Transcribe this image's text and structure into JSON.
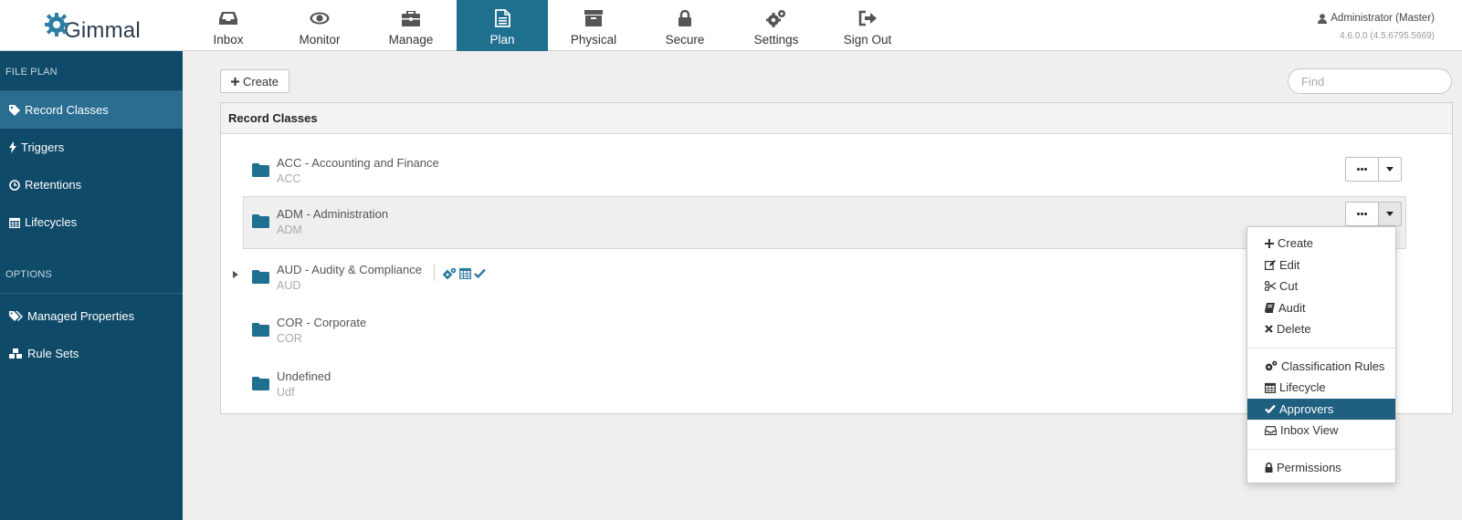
{
  "brand": {
    "name": "Gimmal"
  },
  "nav": [
    {
      "label": "Inbox",
      "icon": "inbox-icon"
    },
    {
      "label": "Monitor",
      "icon": "eye-icon"
    },
    {
      "label": "Manage",
      "icon": "briefcase-icon"
    },
    {
      "label": "Plan",
      "icon": "document-icon",
      "active": true
    },
    {
      "label": "Physical",
      "icon": "archive-box-icon"
    },
    {
      "label": "Secure",
      "icon": "lock-icon"
    },
    {
      "label": "Settings",
      "icon": "gears-icon"
    },
    {
      "label": "Sign Out",
      "icon": "sign-out-icon"
    }
  ],
  "user": {
    "name": "Administrator (Master)",
    "version": "4.6.0.0 (4.5.6795.5669)"
  },
  "sidebar": {
    "section1": "FILE PLAN",
    "items1": [
      {
        "label": "Record Classes",
        "icon": "tag-icon",
        "active": true
      },
      {
        "label": "Triggers",
        "icon": "bolt-icon"
      },
      {
        "label": "Retentions",
        "icon": "clock-icon"
      },
      {
        "label": "Lifecycles",
        "icon": "calendar-icon"
      }
    ],
    "section2": "OPTIONS",
    "items2": [
      {
        "label": "Managed Properties",
        "icon": "tags-icon"
      },
      {
        "label": "Rule Sets",
        "icon": "cubes-icon"
      }
    ]
  },
  "toolbar": {
    "create_label": "Create",
    "find_placeholder": "Find"
  },
  "panel": {
    "title": "Record Classes"
  },
  "record_classes": [
    {
      "name": "ACC - Accounting and Finance",
      "code": "ACC"
    },
    {
      "name": "ADM - Administration",
      "code": "ADM",
      "selected": true
    },
    {
      "name": "AUD - Audity & Compliance",
      "code": "AUD",
      "expandable": true,
      "badges": [
        "gears-icon",
        "calendar-icon",
        "check-icon"
      ]
    },
    {
      "name": "COR - Corporate",
      "code": "COR"
    },
    {
      "name": "Undefined",
      "code": "Udf"
    }
  ],
  "menu": {
    "group1": [
      {
        "label": "Create",
        "icon": "plus-icon"
      },
      {
        "label": "Edit",
        "icon": "edit-icon"
      },
      {
        "label": "Cut",
        "icon": "scissors-icon"
      },
      {
        "label": "Audit",
        "icon": "book-icon"
      },
      {
        "label": "Delete",
        "icon": "times-icon"
      }
    ],
    "group2": [
      {
        "label": "Classification Rules",
        "icon": "gears-icon"
      },
      {
        "label": "Lifecycle",
        "icon": "calendar-icon"
      },
      {
        "label": "Approvers",
        "icon": "check-icon",
        "active": true
      },
      {
        "label": "Inbox View",
        "icon": "inbox-icon"
      }
    ],
    "group3": [
      {
        "label": "Permissions",
        "icon": "lock-icon"
      }
    ]
  },
  "colors": {
    "sidebar": "#0f4a68",
    "accent": "#1f6f8f",
    "folder": "#1f6f8f",
    "menu_active": "#1f5f80"
  }
}
